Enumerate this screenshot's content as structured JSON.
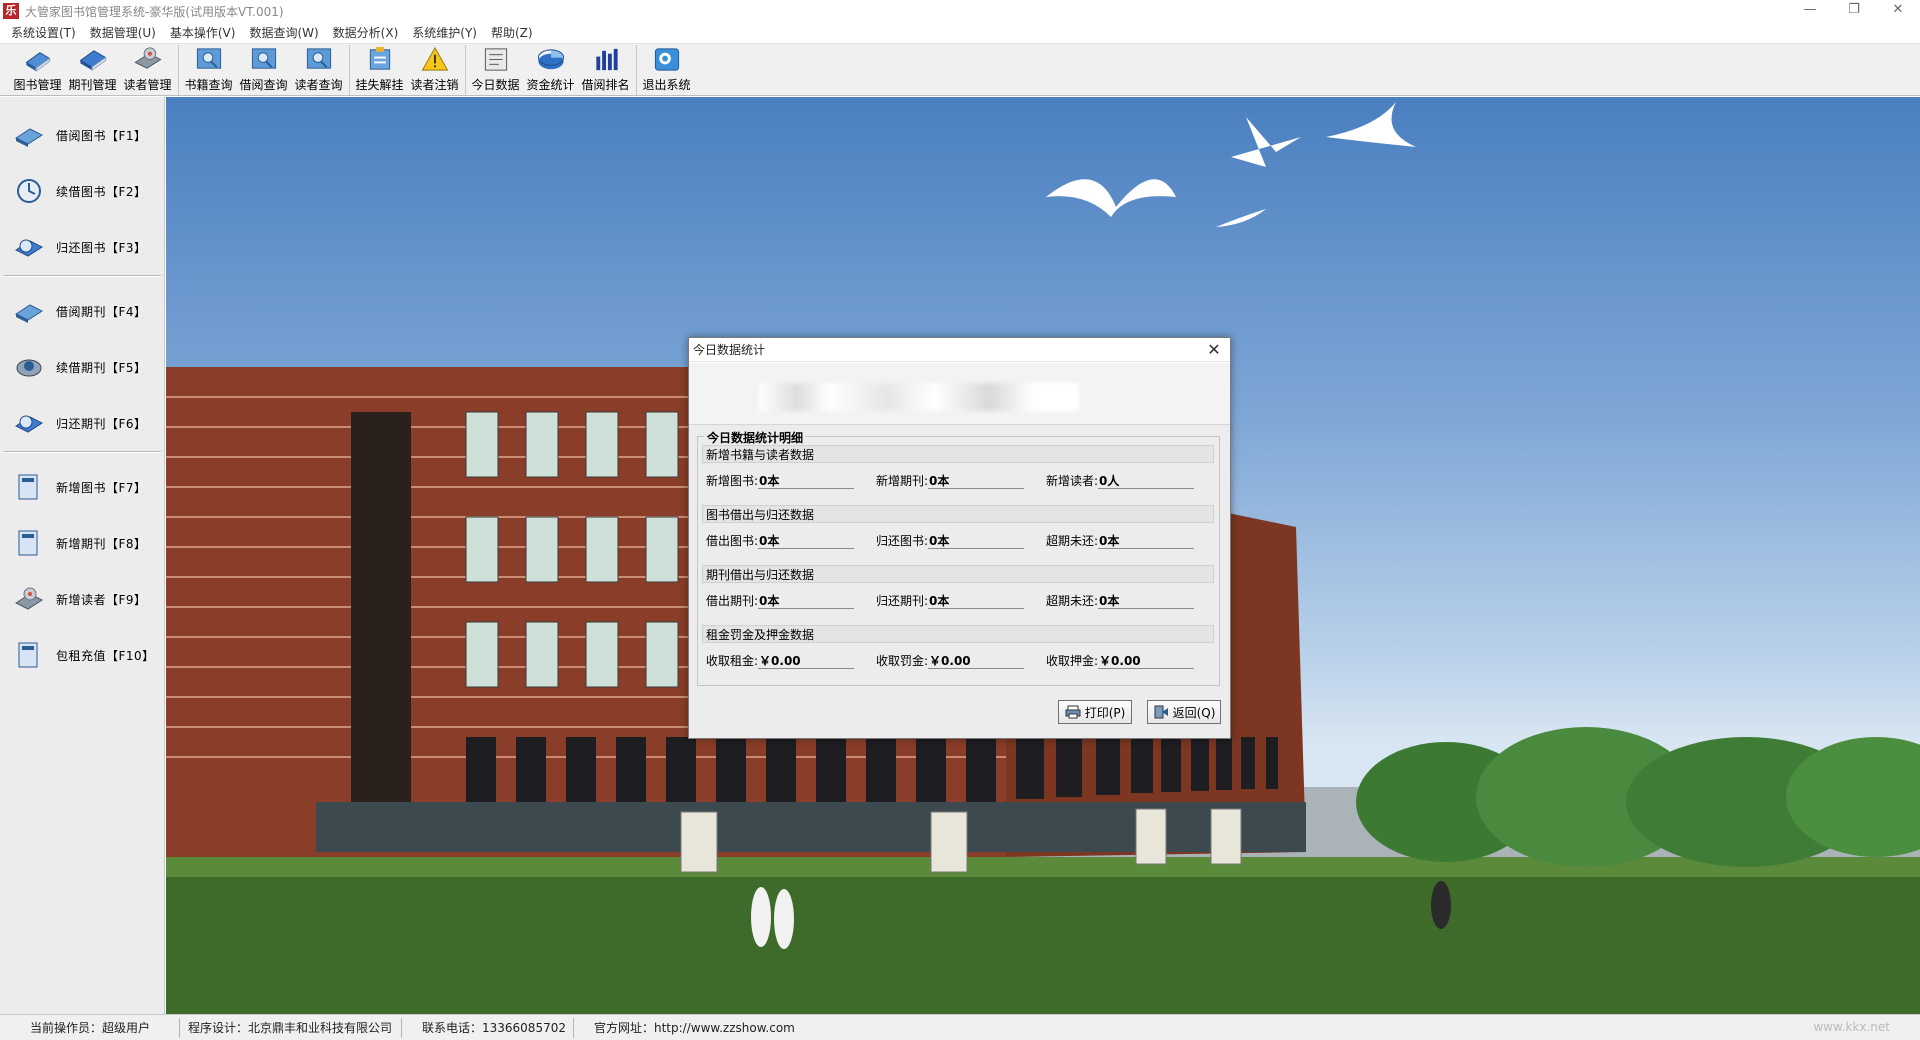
{
  "window": {
    "title": "大管家图书馆管理系统-豪华版(试用版本VT.001)",
    "app_icon_glyph": "乐",
    "controls": [
      "—",
      "❐",
      "✕"
    ]
  },
  "menu": [
    "系统设置(T)",
    "数据管理(U)",
    "基本操作(V)",
    "数据查询(W)",
    "数据分析(X)",
    "系统维护(Y)",
    "帮助(Z)"
  ],
  "toolbar": {
    "groups": [
      [
        {
          "label": "图书管理",
          "icon": "book-icon"
        },
        {
          "label": "期刊管理",
          "icon": "journal-icon"
        },
        {
          "label": "读者管理",
          "icon": "reader-icon"
        }
      ],
      [
        {
          "label": "书籍查询",
          "icon": "book-search-icon"
        },
        {
          "label": "借阅查询",
          "icon": "borrow-search-icon"
        },
        {
          "label": "读者查询",
          "icon": "reader-search-icon"
        }
      ],
      [
        {
          "label": "挂失解挂",
          "icon": "report-loss-icon"
        },
        {
          "label": "读者注销",
          "icon": "reader-cancel-icon"
        }
      ],
      [
        {
          "label": "今日数据",
          "icon": "today-data-icon"
        },
        {
          "label": "资金统计",
          "icon": "pie-chart-icon"
        },
        {
          "label": "借阅排名",
          "icon": "bar-chart-icon"
        }
      ],
      [
        {
          "label": "退出系统",
          "icon": "exit-icon"
        }
      ]
    ]
  },
  "sidebar": {
    "items": [
      {
        "label": "借阅图书【F1】",
        "icon": "borrow-book-icon"
      },
      {
        "label": "续借图书【F2】",
        "icon": "renew-book-icon"
      },
      {
        "label": "归还图书【F3】",
        "icon": "return-book-icon"
      },
      {
        "label": "借阅期刊【F4】",
        "icon": "borrow-journal-icon"
      },
      {
        "label": "续借期刊【F5】",
        "icon": "renew-journal-icon"
      },
      {
        "label": "归还期刊【F6】",
        "icon": "return-journal-icon"
      },
      {
        "label": "新增图书【F7】",
        "icon": "add-book-icon"
      },
      {
        "label": "新增期刊【F8】",
        "icon": "add-journal-icon"
      },
      {
        "label": "新增读者【F9】",
        "icon": "add-reader-icon"
      },
      {
        "label": "包租充值【F10】",
        "icon": "recharge-icon"
      }
    ]
  },
  "dialog": {
    "title": "今日数据统计",
    "close": "✕",
    "group_title": "今日数据统计明细",
    "sections": [
      {
        "heading": "新增书籍与读者数据",
        "fields": [
          {
            "label": "新增图书:",
            "value": "0本"
          },
          {
            "label": "新增期刊:",
            "value": "0本"
          },
          {
            "label": "新增读者:",
            "value": "0人"
          }
        ]
      },
      {
        "heading": "图书借出与归还数据",
        "fields": [
          {
            "label": "借出图书:",
            "value": "0本"
          },
          {
            "label": "归还图书:",
            "value": "0本"
          },
          {
            "label": "超期未还:",
            "value": "0本"
          }
        ]
      },
      {
        "heading": "期刊借出与归还数据",
        "fields": [
          {
            "label": "借出期刊:",
            "value": "0本"
          },
          {
            "label": "归还期刊:",
            "value": "0本"
          },
          {
            "label": "超期未还:",
            "value": "0本"
          }
        ]
      },
      {
        "heading": "租金罚金及押金数据",
        "fields": [
          {
            "label": "收取租金:",
            "value": "￥0.00"
          },
          {
            "label": "收取罚金:",
            "value": "￥0.00"
          },
          {
            "label": "收取押金:",
            "value": "￥0.00"
          }
        ]
      }
    ],
    "print_button": "打印(P)",
    "back_button": "返回(Q)"
  },
  "status": {
    "operator": "当前操作员：超级用户",
    "designer": "程序设计：北京鼎丰和业科技有限公司",
    "phone": "联系电话：13366085702",
    "website": "官方网址：http://www.zzshow.com"
  },
  "watermark": "www.kkx.net"
}
